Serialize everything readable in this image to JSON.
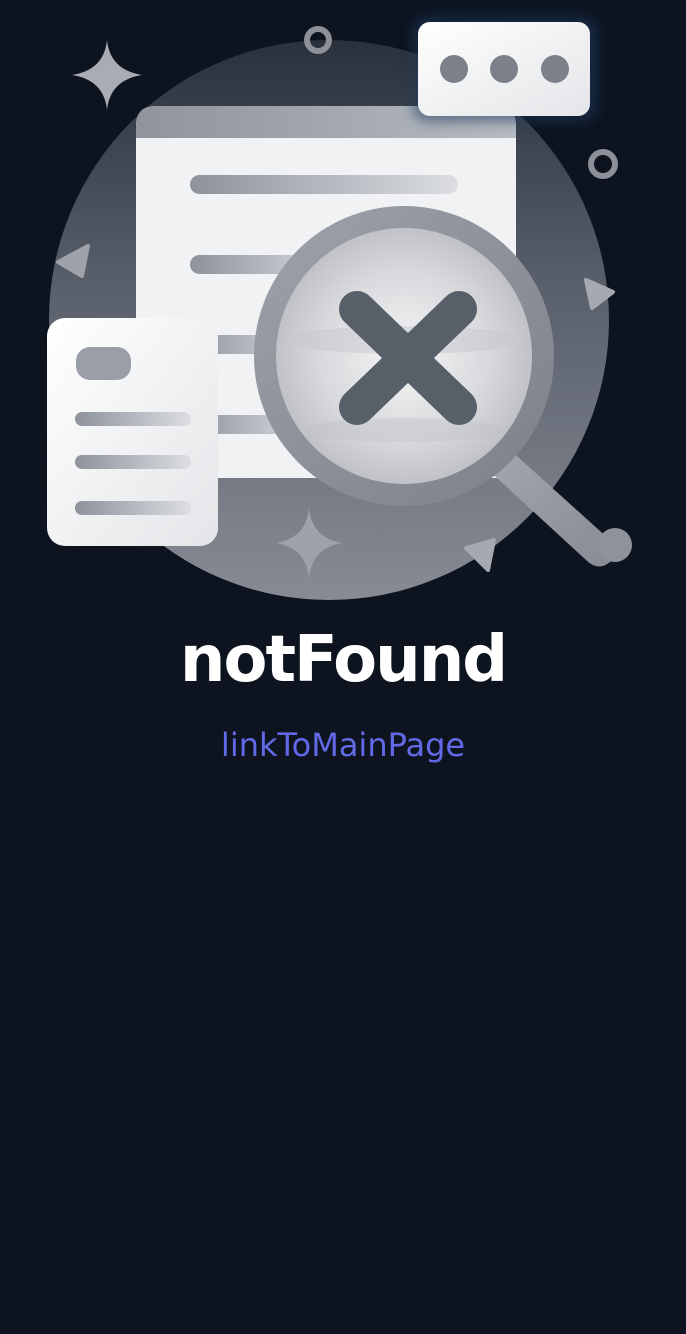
{
  "not_found": {
    "title": "notFound",
    "link_label": "linkToMainPage"
  },
  "illustration": {
    "icons": [
      "sparkle-icon",
      "ring-icon",
      "triangle-icon",
      "document-icon",
      "magnifier-icon",
      "close-icon",
      "chat-bubble-icon",
      "note-card-icon"
    ]
  },
  "colors": {
    "background": "#0d131f",
    "title": "#ffffff",
    "link": "#6269e6"
  }
}
